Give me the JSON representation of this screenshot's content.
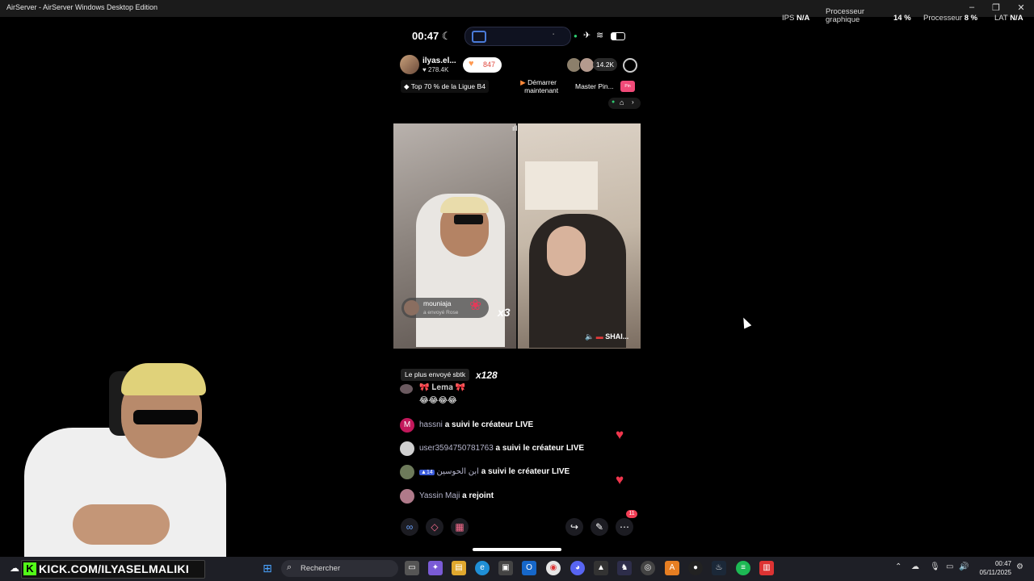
{
  "window": {
    "title": "AirServer - AirServer Windows Desktop Edition"
  },
  "overlay": {
    "ips_label": "IPS",
    "ips_value": "N/A",
    "gpu_label_1": "Processeur",
    "gpu_label_2": "graphique",
    "gpu_value": "14 %",
    "cpu_label": "Processeur",
    "cpu_value": "8 %",
    "lat_label": "LAT",
    "lat_value": "N/A"
  },
  "phone_status": {
    "time": "00:47"
  },
  "live": {
    "host_name": "ilyas.el...",
    "host_likes": "278.4K",
    "like_count": "847",
    "viewer_count": "14.2K",
    "league_badge": "Top 70 % de la Ligue B4",
    "start_label_1": "Démarrer",
    "start_label_2": "maintenant",
    "master_label": "Master Pin...",
    "pin_badge": "Pin"
  },
  "video": {
    "gift_user": "mouniaja",
    "gift_sub": "a envoyé Rose",
    "gift_multiplier": "x3",
    "guest_label": "SHAI..."
  },
  "chat": {
    "most_sent_label": "Le plus envoyé sbtk",
    "most_sent_count": "x128",
    "top_line": "𝐋𝐞𝐦𝐚",
    "emoji_line": "😂😂😂😂",
    "messages": [
      {
        "user": "hassni",
        "text": "a suivi le créateur LIVE",
        "avatar_letter": "M",
        "avatar_color": "#c2185b"
      },
      {
        "user": "user3594750781763",
        "text": "a suivi le créateur LIVE",
        "avatar_letter": "",
        "avatar_color": "#cfcfcf"
      },
      {
        "user": "ابن الحوسين",
        "badge": "14",
        "text": "a suivi le créateur LIVE",
        "avatar_letter": "",
        "avatar_color": "#6d7a5a"
      },
      {
        "user": "Yassin Maji",
        "text": "a rejoint",
        "avatar_letter": "",
        "avatar_color": "#b07a8a"
      }
    ]
  },
  "bottom_tools": {
    "notification_count": "11"
  },
  "stream_overlay": {
    "kick_url": "KICK.COM/ILYASELMALIKI"
  },
  "taskbar": {
    "search_placeholder": "Rechercher",
    "time": "00:47",
    "date": "05/11/2025"
  },
  "colors": {
    "heart": "#f0364d",
    "kick_green": "#53fc18",
    "like_orange": "#ff9a52"
  }
}
